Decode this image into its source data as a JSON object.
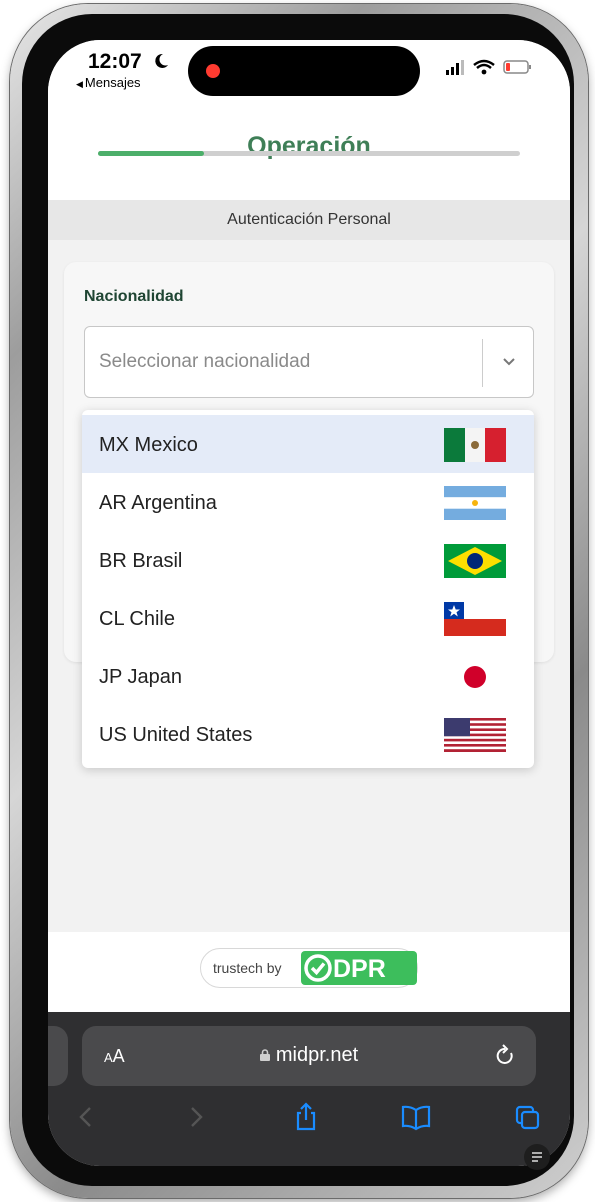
{
  "status_bar": {
    "time": "12:07",
    "back_label": "Mensajes"
  },
  "header": {
    "title": "Operación",
    "progress_fraction": 0.25,
    "subtitle": "Autenticación Personal"
  },
  "form": {
    "nationality_label": "Nacionalidad",
    "nationality_placeholder": "Seleccionar nacionalidad"
  },
  "dropdown": {
    "options": [
      {
        "code": "MX",
        "label": "MX Mexico",
        "flag": "mexico-flag-icon",
        "selected": true
      },
      {
        "code": "AR",
        "label": "AR Argentina",
        "flag": "argentina-flag-icon"
      },
      {
        "code": "BR",
        "label": "BR Brasil",
        "flag": "brazil-flag-icon"
      },
      {
        "code": "CL",
        "label": "CL Chile",
        "flag": "chile-flag-icon"
      },
      {
        "code": "JP",
        "label": "JP Japan",
        "flag": "japan-flag-icon"
      },
      {
        "code": "US",
        "label": "US United States",
        "flag": "usa-flag-icon"
      }
    ]
  },
  "footer": {
    "trustech": "trustech by",
    "brand": "DPR"
  },
  "browser": {
    "aa_label": "AA",
    "url": "midpr.net"
  },
  "colors": {
    "accent": "#3f7f57",
    "progress": "#4caf6a",
    "selected_bg": "#e4ebf8",
    "brand": "#3dbe5c"
  }
}
